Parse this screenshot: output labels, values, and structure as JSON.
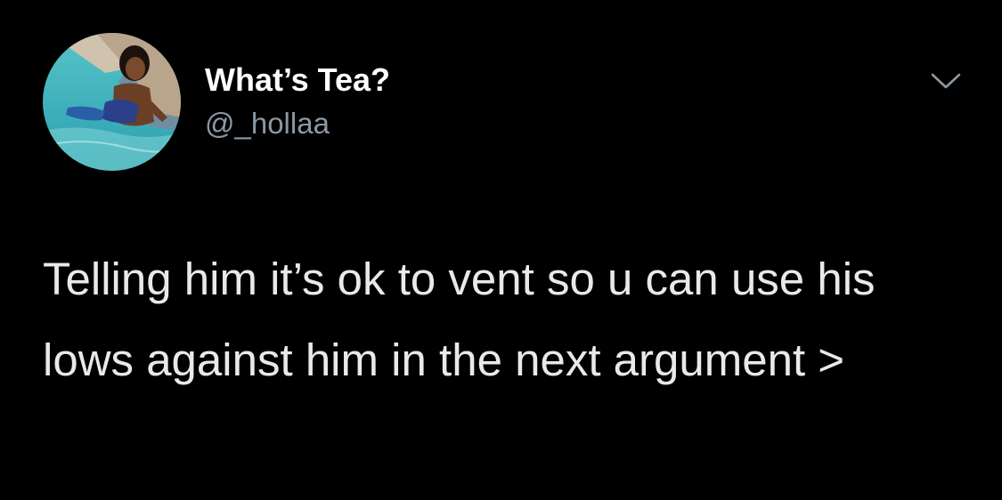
{
  "tweet": {
    "author": {
      "display_name": "What’s Tea?",
      "handle": "@_hollaa"
    },
    "text": "Telling him it’s ok to vent so u can use his lows against him in the next argument >",
    "menu_icon": "chevron-down-icon"
  },
  "colors": {
    "background": "#000000",
    "primary_text": "#ffffff",
    "secondary_text": "#8b98a5"
  }
}
